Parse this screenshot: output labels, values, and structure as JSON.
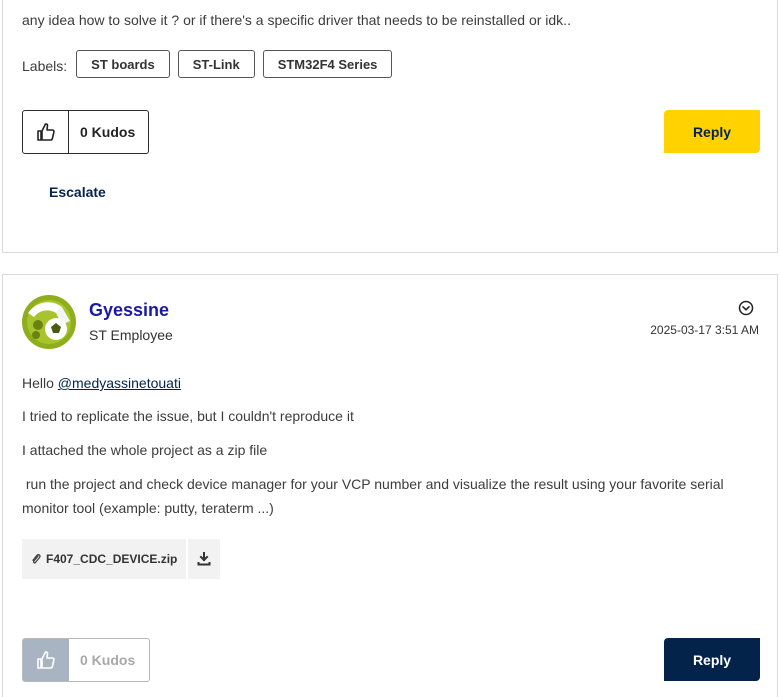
{
  "post1": {
    "body_line": "any idea how to solve it ? or if there's a specific driver that needs to be reinstalled or idk..",
    "labels_title": "Labels:",
    "labels": [
      "ST boards",
      "ST-Link",
      "STM32F4 Series"
    ],
    "kudos_label": "0 Kudos",
    "reply_label": "Reply",
    "escalate_label": "Escalate"
  },
  "post2": {
    "author": "Gyessine",
    "role": "ST Employee",
    "date": "2025-03-17 3:51 AM",
    "greeting": "Hello ",
    "mention": "@medyassinetouati",
    "line1": "I tried to replicate the issue, but I couldn't reproduce it",
    "line2": "I attached the whole project as a zip file",
    "line3a": " run the project and check device manager for your VCP number and visualize the result using your favorite serial",
    "line3b": "monitor tool (example: putty, teraterm ...)",
    "attachment": "F407_CDC_DEVICE.zip",
    "kudos_label": "0 Kudos",
    "reply_label": "Reply"
  },
  "icons": {
    "thumb": "thumbs-up-icon",
    "options": "options-circle-chevron-icon",
    "paperclip": "paperclip-icon",
    "download": "download-icon"
  },
  "colors": {
    "reply_yellow": "#ffd200",
    "reply_navy": "#03234b",
    "author_link": "#1a1aa6",
    "kudos_disabled": "#a9b4c2"
  }
}
